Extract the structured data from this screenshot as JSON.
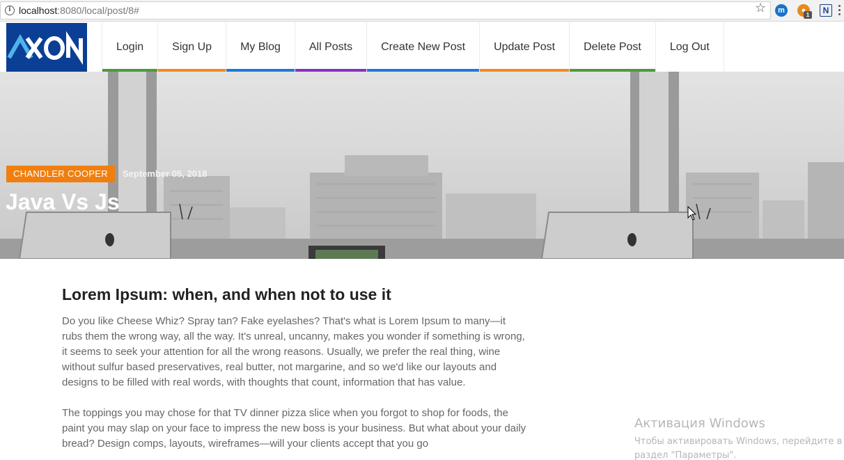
{
  "browser": {
    "url_host": "localhost",
    "url_path": ":8080/local/post/8#",
    "star_icon": "star-icon",
    "extensions": [
      {
        "name": "m",
        "color": "#1a73c8"
      },
      {
        "name": "cookie-extension",
        "color": "#e8891a",
        "badge": "1"
      },
      {
        "name": "N",
        "color": "#1c3f86"
      }
    ]
  },
  "site": {
    "logo_text": "AXON",
    "logo_color": "#0b3f96",
    "nav": [
      {
        "label": "Login",
        "underline": "#4c9a3a"
      },
      {
        "label": "Sign Up",
        "underline": "#f08a1c"
      },
      {
        "label": "My Blog",
        "underline": "#1f7ad6"
      },
      {
        "label": "All Posts",
        "underline": "#8a2fc2"
      },
      {
        "label": "Create New Post",
        "underline": "#1f7ad6"
      },
      {
        "label": "Update Post",
        "underline": "#f08a1c"
      },
      {
        "label": "Delete Post",
        "underline": "#4c9a3a"
      },
      {
        "label": "Log Out",
        "underline": "none"
      }
    ]
  },
  "post": {
    "author": "CHANDLER COOPER",
    "author_badge_color": "#f07f10",
    "date": "September 05, 2018",
    "title": "Java Vs Js",
    "heading": "Lorem Ipsum: when, and when not to use it",
    "paragraphs": [
      "Do you like Cheese Whiz? Spray tan? Fake eyelashes? That's what is Lorem Ipsum to many—it rubs them the wrong way, all the way. It's unreal, uncanny, makes you wonder if something is wrong, it seems to seek your attention for all the wrong reasons. Usually, we prefer the real thing, wine without sulfur based preservatives, real butter, not margarine, and so we'd like our layouts and designs to be filled with real words, with thoughts that count, information that has value.",
      "The toppings you may chose for that TV dinner pizza slice when you forgot to shop for foods, the paint you may slap on your face to impress the new boss is your business. But what about your daily bread? Design comps, layouts, wireframes—will your clients accept that you go"
    ]
  },
  "watermark": {
    "title": "Активация Windows",
    "line1": "Чтобы активировать Windows, перейдите в",
    "line2": "раздел \"Параметры\"."
  }
}
